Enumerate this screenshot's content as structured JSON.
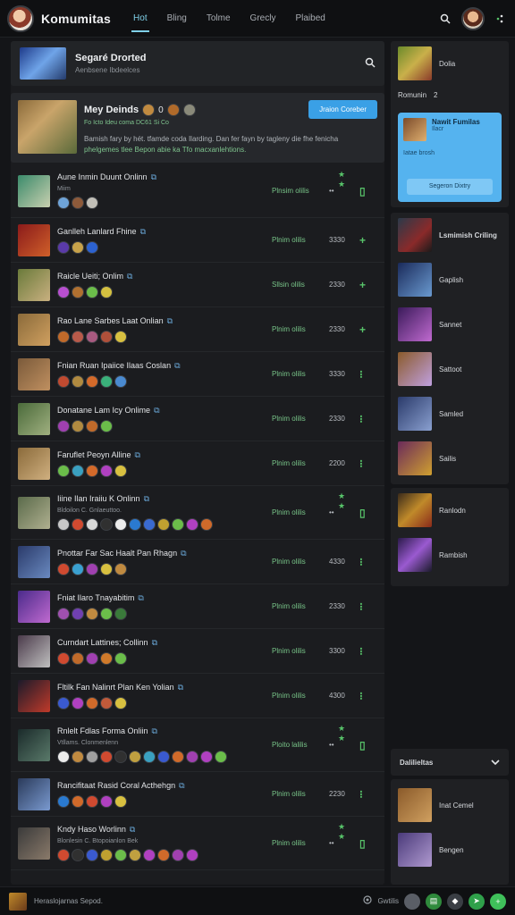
{
  "app": {
    "title": "Komumitas"
  },
  "tabs": [
    {
      "label": "Hot"
    },
    {
      "label": "Bling"
    },
    {
      "label": "Tolme"
    },
    {
      "label": "Grecly"
    },
    {
      "label": "Plaibed"
    }
  ],
  "search_card": {
    "title": "Segaré Drorted",
    "subtitle": "Aenbsene Ibdeelces"
  },
  "featured": {
    "title": "Mey Deinds",
    "count": "0",
    "meta": "Fo Icto Ideu coma DC61 Si Co",
    "join_label": "Jraion Coreber",
    "desc_1": "Bamish fary by hét. tfamde coda Ilarding. Dan fer fayn by tagleny die fhe fenicha",
    "desc_2": "phelgemes tlee Bepon abie ka Tfo macxanlehtions."
  },
  "rows": [
    {
      "title": "Aune Inmin Duunt Onlinn",
      "sub": "Miim",
      "status": "Plnsim olilis",
      "count": "••",
      "action": "▯",
      "stars": "★ ★",
      "chips": [
        "#6fa4d8",
        "#8d5a3a",
        "#c2c0b8"
      ]
    },
    {
      "title": "Ganlleh Lanlard Fhine",
      "status": "Plnim olilis",
      "count": "3330",
      "action": "+",
      "chips": [
        "#5a3aa8",
        "#c7a24a",
        "#2c62d0"
      ]
    },
    {
      "title": "Raicle Ueiti; Onlim",
      "status": "Sllsin olilis",
      "count": "2330",
      "action": "+",
      "chips": [
        "#b84fd0",
        "#b07030",
        "#6bbd4a",
        "#d4c040"
      ]
    },
    {
      "title": "Rao Lane Sarbes Laat Onlian",
      "status": "Plnim olilis",
      "count": "2330",
      "action": "+",
      "chips": [
        "#c06a2a",
        "#b85a4a",
        "#a85a80",
        "#b0503a",
        "#d8c040"
      ]
    },
    {
      "title": "Fnian Ruan Ipaiice Ilaas Coslan",
      "status": "Plnim olilis",
      "count": "3330",
      "action": "⁝",
      "chips": [
        "#c04a30",
        "#b08a40",
        "#d46a2a",
        "#3ab07a",
        "#4a8ad0"
      ]
    },
    {
      "title": "Donatane Lam Icy Onlime",
      "status": "Plnim olilis",
      "count": "2330",
      "action": "⁝",
      "chips": [
        "#a040b0",
        "#b08a40",
        "#c06a2a",
        "#6bbd4a"
      ]
    },
    {
      "title": "Faruflet Peoyn Alline",
      "status": "Plnim olilis",
      "count": "2200",
      "action": "⁝",
      "chips": [
        "#6bbd4a",
        "#3aa0c0",
        "#d46a2a",
        "#b040c0",
        "#d8c040"
      ]
    },
    {
      "title": "Iiine Ilan Iraiiu K Onlinn",
      "sub": "Bldoilon C. Gnlaeuttoo.",
      "status": "Plnim olilis",
      "count": "••",
      "action": "▯",
      "stars": "★ ★",
      "chips": [
        "#c8c8c8",
        "#d04a30",
        "#d8d8d8",
        "#303030",
        "#ececec",
        "#2a7ad0",
        "#3a6ad0",
        "#c0a030",
        "#6bbd4a",
        "#b040c0",
        "#d06a2a"
      ]
    },
    {
      "title": "Pnottar Far Sac Haalt Pan Rhagn",
      "status": "Plnim olilis",
      "count": "4330",
      "action": "⁝",
      "chips": [
        "#d04a30",
        "#3aa0d0",
        "#a040b0",
        "#d8c040",
        "#c08a40"
      ]
    },
    {
      "title": "Fniat Ilaro Tnayabitim",
      "status": "Plnim olilis",
      "count": "2330",
      "action": "⁝",
      "chips": [
        "#a050b0",
        "#7040b0",
        "#c08a40",
        "#6bbd4a",
        "#3a7a3a"
      ]
    },
    {
      "title": "Curndart Lattines; Collinn",
      "status": "Plnim olilis",
      "count": "3300",
      "action": "⁝",
      "chips": [
        "#d04a30",
        "#c06a2a",
        "#a040b0",
        "#d07a2a",
        "#6bbd4a"
      ]
    },
    {
      "title": "Fltilk Fan Nalinrt Plan Ken Yolian",
      "status": "Plnim olilis",
      "count": "4300",
      "action": "⁝",
      "chips": [
        "#3a5ad0",
        "#b040c0",
        "#d06a2a",
        "#c05a3a",
        "#d8c040"
      ]
    },
    {
      "title": "Rnlelt Fdlas Forma Onliin",
      "sub": "Vtllams. Clonmenlenn",
      "status": "Ploito lalilis",
      "count": "••",
      "action": "▯",
      "stars": "★ ★",
      "chips": [
        "#ececec",
        "#c08a40",
        "#a0a0a0",
        "#d04a30",
        "#303030",
        "#c0a040",
        "#3aa0c0",
        "#3a5ad0",
        "#d06a2a",
        "#a040b0",
        "#b040c0",
        "#6bbd4a"
      ]
    },
    {
      "title": "Rancifitaat Rasid Coral Acthehgn",
      "status": "Plnim olilis",
      "count": "2230",
      "action": "⁝",
      "chips": [
        "#2a7ad0",
        "#d06a2a",
        "#d04a30",
        "#b040c0",
        "#d8c040"
      ]
    },
    {
      "title": "Kndy Haso Worlinn",
      "sub": "Blonlesin C. Btopoianlon Bek",
      "status": "Plnim olilis",
      "count": "••",
      "action": "▯",
      "stars": "★ ★",
      "chips": [
        "#d04a30",
        "#303030",
        "#3a5ad0",
        "#c0a030",
        "#6bbd4a",
        "#c0a040",
        "#b040c0",
        "#d06a2a",
        "#a040b0",
        "#b040c0"
      ]
    }
  ],
  "right_panel": {
    "top_item": "Dolia",
    "section_label": "Romunin",
    "section_value": "2",
    "promo": {
      "name": "Nawit Fumilas",
      "sub": "Ilacr",
      "tag": "Iatae brosh",
      "button": "Segeron Dixtry"
    },
    "list_title": "Lsmimish Criling",
    "list_items": [
      "Gaplish",
      "Sannet",
      "Sattoot",
      "Samled",
      "Sailis"
    ],
    "extra_items": [
      "Ranlodn",
      "Rambish"
    ],
    "dropdown_label": "Dalilieltas",
    "bottom_items": [
      "Inat Cemel",
      "Bengen"
    ]
  },
  "bottom_bar": {
    "text": "Heraslojarnas Sepod.",
    "status_label": "Gwtilis"
  }
}
